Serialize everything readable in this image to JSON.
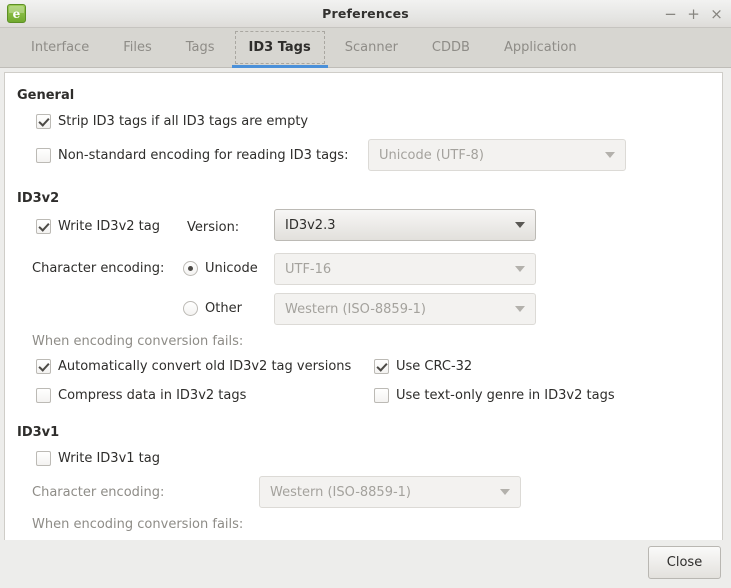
{
  "window": {
    "title": "Preferences",
    "app_icon": "easytag-icon",
    "icon_glyph": "e",
    "controls": {
      "minimize": "−",
      "maximize": "+",
      "close": "×"
    }
  },
  "tabs": [
    {
      "label": "Interface",
      "active": false
    },
    {
      "label": "Files",
      "active": false
    },
    {
      "label": "Tags",
      "active": false
    },
    {
      "label": "ID3 Tags",
      "active": true
    },
    {
      "label": "Scanner",
      "active": false
    },
    {
      "label": "CDDB",
      "active": false
    },
    {
      "label": "Application",
      "active": false
    }
  ],
  "general": {
    "title": "General",
    "strip_tags": {
      "label": "Strip ID3 tags if all ID3 tags are empty",
      "checked": true
    },
    "nonstandard_encoding": {
      "label": "Non-standard encoding for reading ID3 tags:",
      "checked": false
    },
    "nonstandard_encoding_value": "Unicode (UTF-8)"
  },
  "id3v2": {
    "title": "ID3v2",
    "write_tag": {
      "label": "Write ID3v2 tag",
      "checked": true
    },
    "version_label": "Version:",
    "version_value": "ID3v2.3",
    "charset_label": "Character encoding:",
    "unicode_radio": {
      "label": "Unicode",
      "selected": true
    },
    "unicode_value": "UTF-16",
    "other_radio": {
      "label": "Other",
      "selected": false
    },
    "other_value": "Western (ISO-8859-1)",
    "conversion_fails_label": "When encoding conversion fails:",
    "auto_convert": {
      "label": "Automatically convert old ID3v2 tag versions",
      "checked": true
    },
    "use_crc32": {
      "label": "Use CRC-32",
      "checked": true
    },
    "compress_data": {
      "label": "Compress data in ID3v2 tags",
      "checked": false
    },
    "text_only_genre": {
      "label": "Use text-only genre in ID3v2 tags",
      "checked": false
    }
  },
  "id3v1": {
    "title": "ID3v1",
    "write_tag": {
      "label": "Write ID3v1 tag",
      "checked": false
    },
    "charset_label": "Character encoding:",
    "charset_value": "Western (ISO-8859-1)",
    "conversion_fails_label": "When encoding conversion fails:"
  },
  "actions": {
    "close_label": "Close"
  },
  "colors": {
    "accent": "#4a90d9",
    "window_bg": "#ededeb",
    "tabbar_bg": "#d7d6d1",
    "content_bg": "#ffffff",
    "text": "#2e2d2b",
    "text_dim": "#8e8c87"
  }
}
